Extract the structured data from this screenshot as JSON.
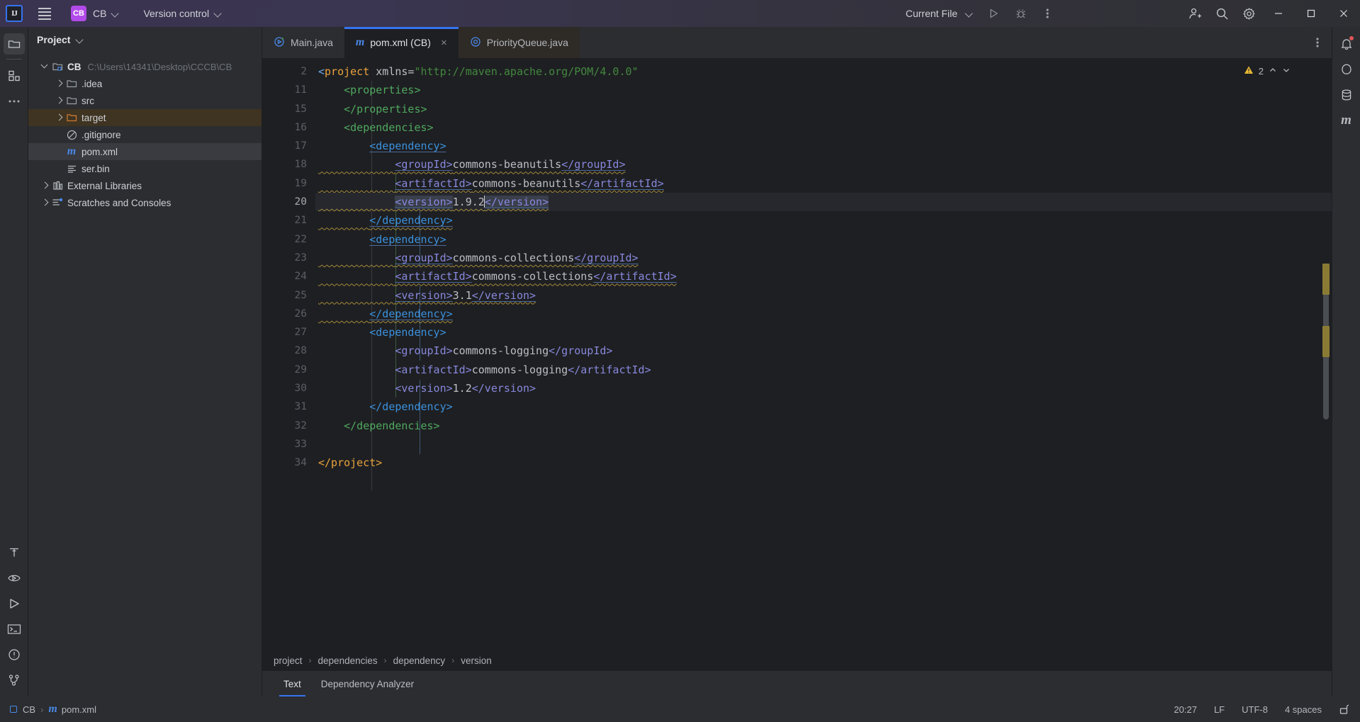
{
  "titlebar": {
    "logo": "IJ",
    "menu_icon": "hamburger-icon",
    "project_chip": "CB",
    "project_name": "CB",
    "version_control": "Version control",
    "run_config": "Current File",
    "run_icon": "run-icon",
    "debug_icon": "debug-icon",
    "more_icon": "more-vertical-icon",
    "account_icon": "add-user-icon",
    "search_icon": "search-icon",
    "settings_icon": "gear-icon",
    "minimize": "minimize-icon",
    "maximize": "maximize-icon",
    "close": "close-icon"
  },
  "left_rail": {
    "top": [
      "project-icon",
      "commit-icon",
      "more-tools-icon"
    ],
    "bottom": [
      "build-icon",
      "coverage-icon",
      "run-icon",
      "terminal-icon",
      "problems-icon",
      "git-branch-icon"
    ]
  },
  "right_rail": {
    "items": [
      "notifications-icon",
      "ai-assistant-icon",
      "database-icon",
      "maven-icon"
    ]
  },
  "project_panel": {
    "title": "Project",
    "tree": [
      {
        "label": "CB",
        "path": "C:\\Users\\14341\\Desktop\\CCCB\\CB",
        "icon": "module-folder-icon",
        "state": "open",
        "depth": 0,
        "bold": true
      },
      {
        "label": ".idea",
        "icon": "folder-icon",
        "state": "closed",
        "depth": 1
      },
      {
        "label": "src",
        "icon": "folder-icon",
        "state": "closed",
        "depth": 1
      },
      {
        "label": "target",
        "icon": "folder-orange-icon",
        "state": "closed",
        "depth": 1,
        "highlight": "target"
      },
      {
        "label": ".gitignore",
        "icon": "gitignore-icon",
        "depth": 1
      },
      {
        "label": "pom.xml",
        "icon": "maven-m-icon",
        "depth": 1,
        "highlight": "file"
      },
      {
        "label": "ser.bin",
        "icon": "file-lines-icon",
        "depth": 1
      },
      {
        "label": "External Libraries",
        "icon": "libraries-icon",
        "state": "closed",
        "depth": 0
      },
      {
        "label": "Scratches and Consoles",
        "icon": "scratches-icon",
        "state": "closed",
        "depth": 0
      }
    ]
  },
  "editor": {
    "tabs": [
      {
        "label": "Main.java",
        "icon": "java-class-run-icon",
        "active": false,
        "closable": false
      },
      {
        "label": "pom.xml (CB)",
        "icon": "maven-m-icon",
        "active": true,
        "closable": true,
        "close_glyph": "×"
      },
      {
        "label": "PriorityQueue.java",
        "icon": "java-class-icon",
        "active": false,
        "closable": false
      }
    ],
    "tab_options_icon": "more-vertical-icon",
    "inspections": {
      "count": "2",
      "warning_icon": "warning-triangle-icon",
      "up": "chevron-up-icon",
      "down": "chevron-down-icon"
    },
    "lines": [
      {
        "n": "2",
        "html": "<span class=\"tok-br\">&lt;</span><span class=\"tok-tag\">project</span> <span class=\"tok-attr\">xmlns</span><span class=\"tok-txt\">=</span><span class=\"tok-str\">\"http://maven.apache.org/POM/4.0.0\"</span>"
      },
      {
        "n": "11",
        "html": "&nbsp;&nbsp;&nbsp;&nbsp;<span class=\"tok-tag2\">&lt;properties&gt;</span>"
      },
      {
        "n": "15",
        "html": "&nbsp;&nbsp;&nbsp;&nbsp;<span class=\"tok-tag2\">&lt;/properties&gt;</span>"
      },
      {
        "n": "16",
        "html": "&nbsp;&nbsp;&nbsp;&nbsp;<span class=\"tok-tag2\">&lt;dependencies&gt;</span>"
      },
      {
        "n": "17",
        "html": "&nbsp;&nbsp;&nbsp;&nbsp;&nbsp;&nbsp;&nbsp;&nbsp;<span class=\"tok-blue undl wavy\">&lt;dependency&gt;</span>"
      },
      {
        "n": "18",
        "html": "<span class=\"wavy\">&nbsp;&nbsp;&nbsp;&nbsp;&nbsp;&nbsp;&nbsp;&nbsp;&nbsp;&nbsp;&nbsp;&nbsp;<span class=\"tok-name undl\">&lt;groupId&gt;</span><span class=\"tok-txt\">commons-beanutils</span><span class=\"tok-name undl\">&lt;/groupId&gt;</span></span>"
      },
      {
        "n": "19",
        "html": "<span class=\"wavy\">&nbsp;&nbsp;&nbsp;&nbsp;&nbsp;&nbsp;&nbsp;&nbsp;&nbsp;&nbsp;&nbsp;&nbsp;<span class=\"tok-name undl\">&lt;artifactId&gt;</span><span class=\"tok-txt\">commons-beanutils</span><span class=\"tok-name undl\">&lt;/artifactId&gt;</span></span>"
      },
      {
        "n": "20",
        "html": "<span class=\"wavy\">&nbsp;&nbsp;&nbsp;&nbsp;&nbsp;&nbsp;&nbsp;&nbsp;&nbsp;&nbsp;&nbsp;&nbsp;<span class=\"tok-name undl sel\">&lt;version&gt;</span><span class=\"tok-txt\">1.9.2</span><span class=\"caret\"></span><span class=\"tok-name undl sel\">&lt;/version&gt;</span></span>",
        "current": true
      },
      {
        "n": "21",
        "html": "<span class=\"wavy\">&nbsp;&nbsp;&nbsp;&nbsp;&nbsp;&nbsp;&nbsp;&nbsp;<span class=\"tok-blue undl\">&lt;/dependency&gt;</span></span>"
      },
      {
        "n": "22",
        "html": "&nbsp;&nbsp;&nbsp;&nbsp;&nbsp;&nbsp;&nbsp;&nbsp;<span class=\"tok-blue undl wavy\">&lt;dependency&gt;</span>"
      },
      {
        "n": "23",
        "html": "<span class=\"wavy\">&nbsp;&nbsp;&nbsp;&nbsp;&nbsp;&nbsp;&nbsp;&nbsp;&nbsp;&nbsp;&nbsp;&nbsp;<span class=\"tok-name undl\">&lt;groupId&gt;</span><span class=\"tok-txt\">commons-collections</span><span class=\"tok-name undl\">&lt;/groupId&gt;</span></span>"
      },
      {
        "n": "24",
        "html": "<span class=\"wavy\">&nbsp;&nbsp;&nbsp;&nbsp;&nbsp;&nbsp;&nbsp;&nbsp;&nbsp;&nbsp;&nbsp;&nbsp;<span class=\"tok-name undl\">&lt;artifactId&gt;</span><span class=\"tok-txt\">commons-collections</span><span class=\"tok-name undl\">&lt;/artifactId&gt;</span></span>"
      },
      {
        "n": "25",
        "html": "<span class=\"wavy\">&nbsp;&nbsp;&nbsp;&nbsp;&nbsp;&nbsp;&nbsp;&nbsp;&nbsp;&nbsp;&nbsp;&nbsp;<span class=\"tok-name undl\">&lt;version&gt;</span><span class=\"tok-txt\">3.1</span><span class=\"tok-name undl\">&lt;/version&gt;</span></span>"
      },
      {
        "n": "26",
        "html": "<span class=\"wavy\">&nbsp;&nbsp;&nbsp;&nbsp;&nbsp;&nbsp;&nbsp;&nbsp;<span class=\"tok-blue undl\">&lt;/dependency&gt;</span></span>"
      },
      {
        "n": "27",
        "html": "&nbsp;&nbsp;&nbsp;&nbsp;&nbsp;&nbsp;&nbsp;&nbsp;<span class=\"tok-blue\">&lt;dependency&gt;</span>"
      },
      {
        "n": "28",
        "html": "&nbsp;&nbsp;&nbsp;&nbsp;&nbsp;&nbsp;&nbsp;&nbsp;&nbsp;&nbsp;&nbsp;&nbsp;<span class=\"tok-name\">&lt;groupId&gt;</span><span class=\"tok-txt\">commons-logging</span><span class=\"tok-name\">&lt;/groupId&gt;</span>"
      },
      {
        "n": "29",
        "html": "&nbsp;&nbsp;&nbsp;&nbsp;&nbsp;&nbsp;&nbsp;&nbsp;&nbsp;&nbsp;&nbsp;&nbsp;<span class=\"tok-name\">&lt;artifactId&gt;</span><span class=\"tok-txt\">commons-logging</span><span class=\"tok-name\">&lt;/artifactId&gt;</span>"
      },
      {
        "n": "30",
        "html": "&nbsp;&nbsp;&nbsp;&nbsp;&nbsp;&nbsp;&nbsp;&nbsp;&nbsp;&nbsp;&nbsp;&nbsp;<span class=\"tok-name\">&lt;version&gt;</span><span class=\"tok-txt\">1.2</span><span class=\"tok-name\">&lt;/version&gt;</span>"
      },
      {
        "n": "31",
        "html": "&nbsp;&nbsp;&nbsp;&nbsp;&nbsp;&nbsp;&nbsp;&nbsp;<span class=\"tok-blue\">&lt;/dependency&gt;</span>"
      },
      {
        "n": "32",
        "html": "&nbsp;&nbsp;&nbsp;&nbsp;<span class=\"tok-tag2\">&lt;/dependencies&gt;</span>"
      },
      {
        "n": "33",
        "html": ""
      },
      {
        "n": "34",
        "html": "<span class=\"tok-tag\">&lt;/project&gt;</span>"
      }
    ],
    "breadcrumbs": [
      "project",
      "dependencies",
      "dependency",
      "version"
    ],
    "breadcrumb_sep": "›",
    "bottom_tabs": [
      {
        "label": "Text",
        "active": true
      },
      {
        "label": "Dependency Analyzer",
        "active": false
      }
    ]
  },
  "status_bar": {
    "module": "CB",
    "sep": "›",
    "file": "pom.xml",
    "file_icon": "maven-m-icon",
    "caret_position": "20:27",
    "line_separator": "LF",
    "encoding": "UTF-8",
    "indent": "4 spaces",
    "lock_icon": "unlocked-icon"
  },
  "colors": {
    "accent": "#3574f0",
    "titlebar_purple": "#3b3450",
    "project_chip": "#b14ae8",
    "warning": "#a58b3a",
    "panel_bg": "#2b2d30",
    "editor_bg": "#1e1f22"
  }
}
